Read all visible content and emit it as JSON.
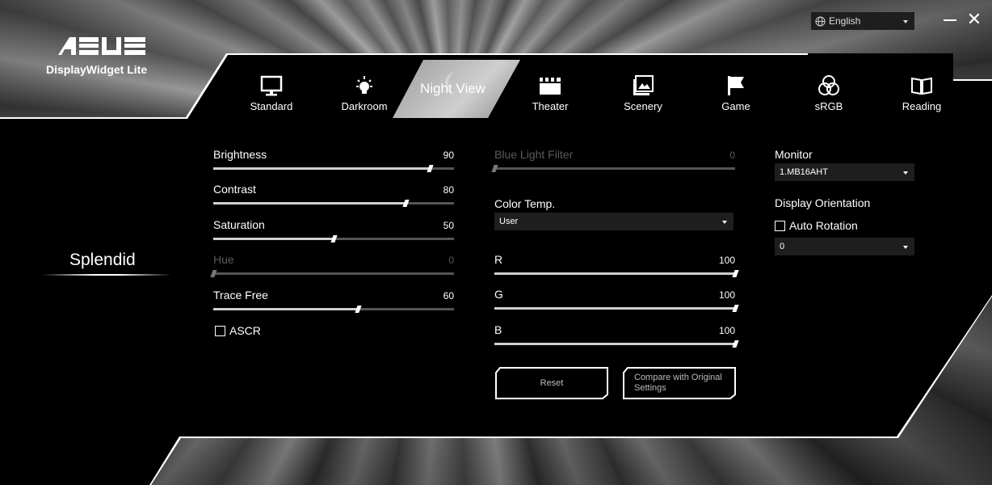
{
  "app": {
    "logo_text": "ASUS",
    "title": "DisplayWidget Lite"
  },
  "language": {
    "selected": "English"
  },
  "tabs": [
    {
      "label": "Standard",
      "icon": "monitor-icon",
      "active": false
    },
    {
      "label": "Darkroom",
      "icon": "lightbulb-icon",
      "active": false
    },
    {
      "label": "Night View",
      "icon": "moon-icon",
      "active": true
    },
    {
      "label": "Theater",
      "icon": "clapperboard-icon",
      "active": false
    },
    {
      "label": "Scenery",
      "icon": "image-icon",
      "active": false
    },
    {
      "label": "Game",
      "icon": "flag-icon",
      "active": false
    },
    {
      "label": "sRGB",
      "icon": "rgb-circles-icon",
      "active": false
    },
    {
      "label": "Reading",
      "icon": "book-icon",
      "active": false
    }
  ],
  "nav": {
    "section": "Splendid"
  },
  "sliders_left": [
    {
      "label": "Brightness",
      "value": "90",
      "level": 0.9,
      "disabled": false
    },
    {
      "label": "Contrast",
      "value": "80",
      "level": 0.8,
      "disabled": false
    },
    {
      "label": "Saturation",
      "value": "50",
      "level": 0.5,
      "disabled": false
    },
    {
      "label": "Hue",
      "value": "0",
      "level": 0.0,
      "disabled": true
    },
    {
      "label": "Trace Free",
      "value": "60",
      "level": 0.6,
      "disabled": false
    }
  ],
  "ascr": {
    "label": "ASCR",
    "checked": false
  },
  "blue_light": {
    "label": "Blue Light Filter",
    "value": "0",
    "level": 0.0,
    "disabled": true
  },
  "color_temp": {
    "label": "Color Temp.",
    "selected": "User"
  },
  "rgb": [
    {
      "label": "R",
      "value": "100",
      "level": 1.0
    },
    {
      "label": "G",
      "value": "100",
      "level": 1.0
    },
    {
      "label": "B",
      "value": "100",
      "level": 1.0
    }
  ],
  "buttons": {
    "reset": "Reset",
    "compare": "Compare with Original Settings"
  },
  "monitor": {
    "label": "Monitor",
    "selected": "1.MB16AHT"
  },
  "orientation": {
    "label": "Display Orientation",
    "auto_rotation": "Auto Rotation",
    "auto_checked": false,
    "selected": "0"
  }
}
